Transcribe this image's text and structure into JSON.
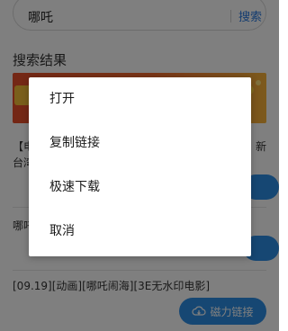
{
  "search": {
    "query": "哪吒",
    "button_label": "搜索"
  },
  "results": {
    "section_title": "搜索结果",
    "row1_left": "【电",
    "row1_right": "新",
    "row1b_left": "台湾",
    "row2_left": "哪吒",
    "row3_title": "[09.19][动画][哪吒闹海][3E无水印电影]",
    "magnet_button_label": "磁力链接"
  },
  "context_menu": {
    "items": [
      {
        "label": "打开"
      },
      {
        "label": "复制链接"
      },
      {
        "label": "极速下载"
      },
      {
        "label": "取消"
      }
    ]
  },
  "colors": {
    "accent": "#2d8fe6",
    "search_link": "#2b7be0",
    "overlay": "rgba(0,0,0,0.5)"
  }
}
